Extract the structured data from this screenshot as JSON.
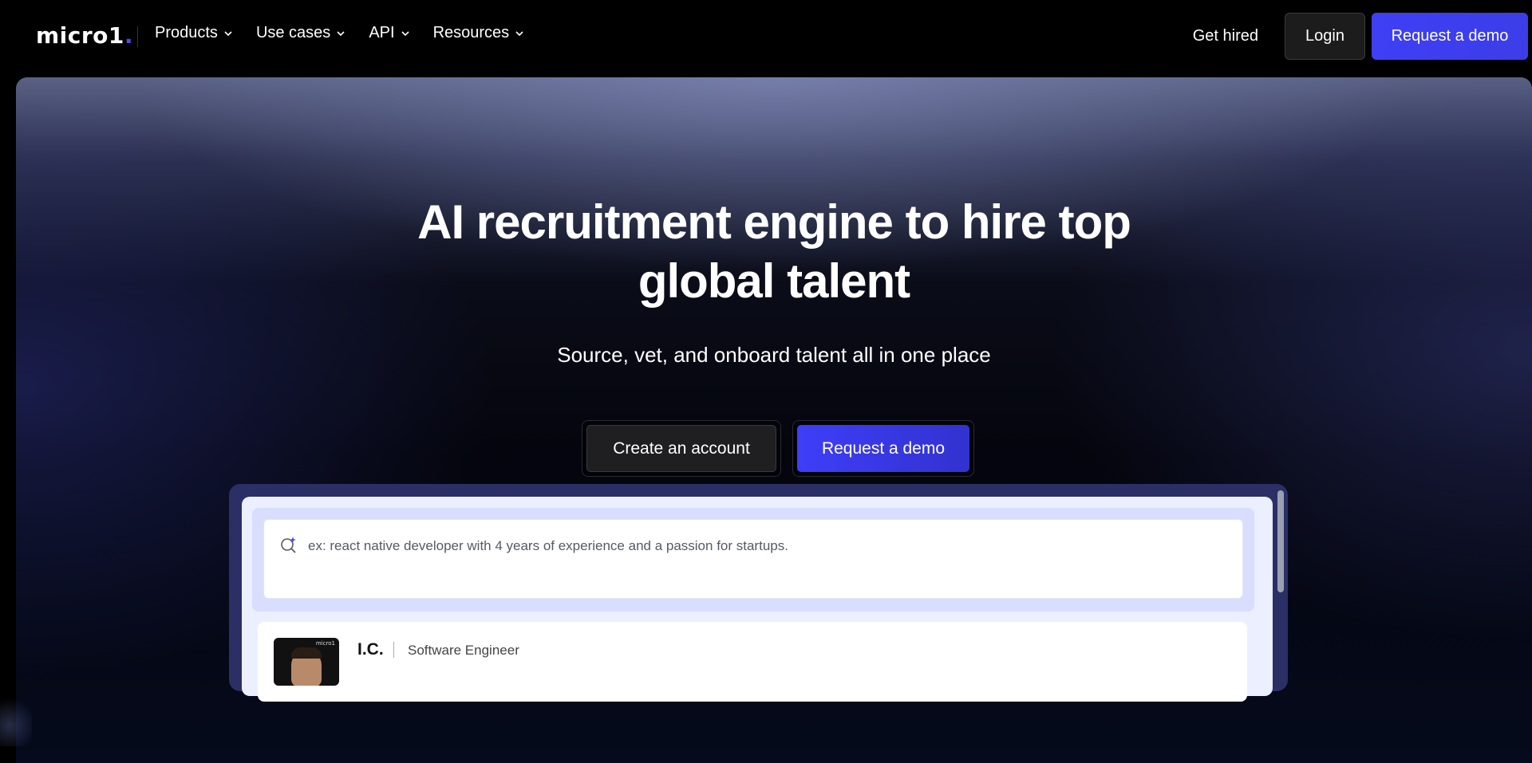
{
  "navbar": {
    "logo_text": "micro1",
    "logo_dot": ".",
    "menu": [
      {
        "label": "Products"
      },
      {
        "label": "Use cases"
      },
      {
        "label": "API"
      },
      {
        "label": "Resources"
      }
    ],
    "get_hired": "Get hired",
    "login": "Login",
    "request_demo": "Request a demo"
  },
  "hero": {
    "title_line1": "AI recruitment engine to hire top",
    "title_line2": "global talent",
    "subtitle": "Source, vet, and onboard talent all in one place",
    "create_account": "Create an account",
    "request_demo": "Request a demo"
  },
  "preview": {
    "search_placeholder": "ex: react native developer with 4 years of experience and a passion for startups.",
    "candidate": {
      "name": "I.C.",
      "role": "Software Engineer",
      "avatar_badge": "micro1"
    }
  },
  "colors": {
    "accent": "#3f3ff5",
    "background": "#000000",
    "preview_frame": "#2a2f66"
  }
}
